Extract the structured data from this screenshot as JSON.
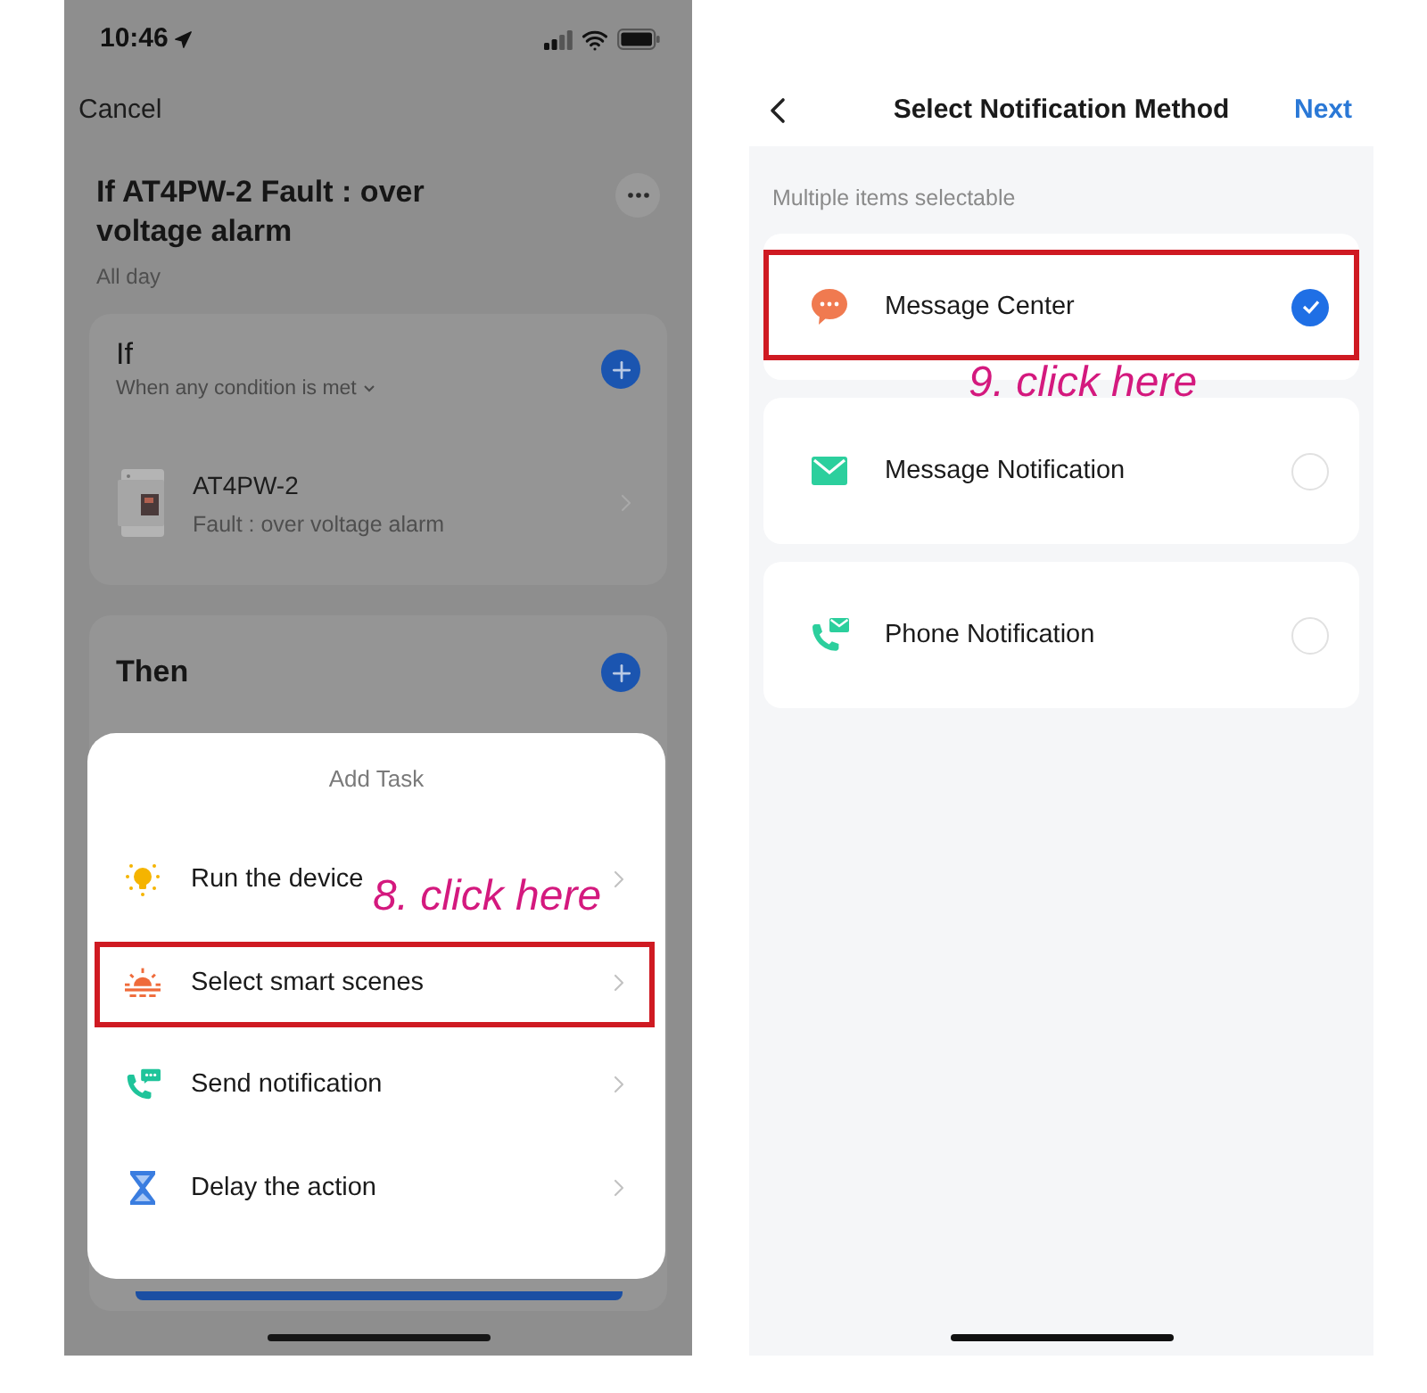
{
  "left_screen": {
    "status_bar": {
      "time": "10:46"
    },
    "cancel": "Cancel",
    "title": "If AT4PW-2 Fault : over voltage alarm",
    "subtitle": "All day",
    "if_card": {
      "title": "If",
      "condition": "When any condition is met",
      "device": {
        "name": "AT4PW-2",
        "status": "Fault : over voltage alarm"
      }
    },
    "then_card": {
      "title": "Then"
    },
    "sheet": {
      "title": "Add Task",
      "items": [
        {
          "label": "Run the device",
          "kind": "device",
          "highlighted": false
        },
        {
          "label": "Select smart scenes",
          "kind": "scene",
          "highlighted": true
        },
        {
          "label": "Send notification",
          "kind": "notification",
          "highlighted": false
        },
        {
          "label": "Delay the action",
          "kind": "delay",
          "highlighted": false
        }
      ]
    },
    "annotation": "8. click here"
  },
  "right_screen": {
    "header": {
      "title": "Select Notification Method",
      "next": "Next"
    },
    "hint": "Multiple items selectable",
    "methods": [
      {
        "label": "Message Center",
        "kind": "message-center",
        "selected": true,
        "highlighted": true
      },
      {
        "label": "Message Notification",
        "kind": "mail",
        "selected": false,
        "highlighted": false
      },
      {
        "label": "Phone Notification",
        "kind": "phone",
        "selected": false,
        "highlighted": false
      }
    ],
    "annotation": "9. click here"
  }
}
